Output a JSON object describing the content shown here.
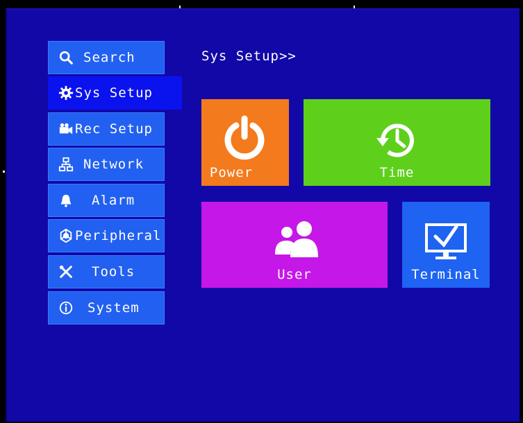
{
  "breadcrumb": "Sys Setup>>",
  "sidebar": {
    "items": [
      {
        "label": "Search",
        "icon": "search-icon"
      },
      {
        "label": "Sys Setup",
        "icon": "gear-icon",
        "active": true
      },
      {
        "label": "Rec Setup",
        "icon": "camera-icon"
      },
      {
        "label": "Network",
        "icon": "network-icon"
      },
      {
        "label": "Alarm",
        "icon": "bell-icon"
      },
      {
        "label": "Peripheral",
        "icon": "peripheral-icon"
      },
      {
        "label": "Tools",
        "icon": "tools-icon"
      },
      {
        "label": "System",
        "icon": "info-icon"
      }
    ]
  },
  "tiles": {
    "power": {
      "label": "Power",
      "color": "#f47a1e",
      "icon": "power-icon"
    },
    "time": {
      "label": "Time",
      "color": "#5ed01c",
      "icon": "clock-history-icon"
    },
    "user": {
      "label": "User",
      "color": "#c417e8",
      "icon": "users-icon"
    },
    "terminal": {
      "label": "Terminal",
      "color": "#1e63f2",
      "icon": "monitor-check-icon"
    }
  },
  "colors": {
    "background": "#1208a8",
    "menu_item": "#2160f0",
    "menu_active": "#0a12ee"
  }
}
